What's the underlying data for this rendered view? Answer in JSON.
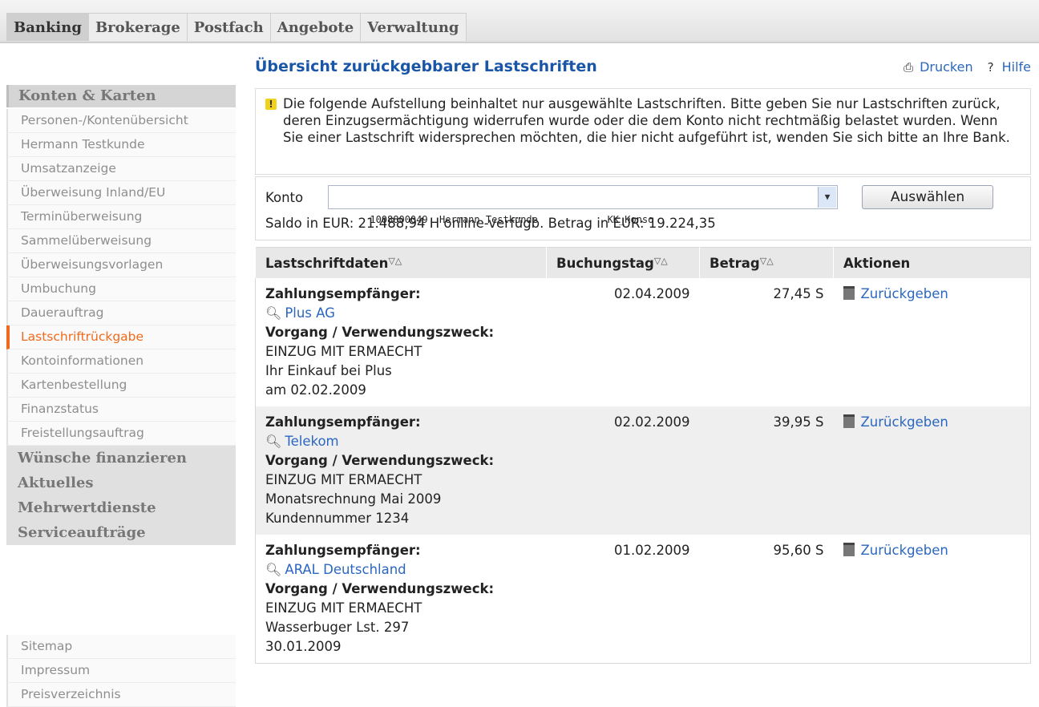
{
  "tabs": [
    "Banking",
    "Brokerage",
    "Postfach",
    "Angebote",
    "Verwaltung"
  ],
  "sidebar": {
    "heading": "Konten & Karten",
    "items": [
      "Personen-/Kontenübersicht",
      "Hermann Testkunde",
      "Umsatzanzeige",
      "Überweisung Inland/EU",
      "Terminüberweisung",
      "Sammelüberweisung",
      "Überweisungsvorlagen",
      "Umbuchung",
      "Dauerauftrag",
      "Lastschriftrückgabe",
      "Kontoinformationen",
      "Kartenbestellung",
      "Finanzstatus",
      "Freistellungsauftrag"
    ],
    "sections": [
      "Wünsche finanzieren",
      "Aktuelles",
      "Mehrwertdienste",
      "Serviceaufträge"
    ],
    "footer": [
      "Sitemap",
      "Impressum",
      "Preisverzeichnis"
    ]
  },
  "main": {
    "title": "Übersicht zurückgebbarer Lastschriften",
    "print_label": "Drucken",
    "help_label": "Hilfe",
    "notice": "Die folgende Aufstellung beinhaltet nur ausgewählte Lastschriften. Bitte geben Sie nur Lastschriften zurück, deren Einzugsermächtigung widerrufen wurde oder die dem Konto nicht rechtmäßig belastet wurden. Wenn Sie einer Lastschrift widersprechen möchten, die hier nicht aufgeführt ist, wenden Sie sich bitte an Ihre Bank.",
    "konto_label": "Konto",
    "konto_value": "1008800049  Hermann Testkunde            KK_Konso",
    "select_button": "Auswählen",
    "saldo": "Saldo in EUR:  21.488,94 H    online-verfügb. Betrag in EUR:  19.224,35"
  },
  "table": {
    "headers": [
      "Lastschriftdaten",
      "Buchungstag",
      "Betrag",
      "Aktionen"
    ],
    "payee_label": "Zahlungsempfänger:",
    "purpose_label": "Vorgang / Verwendungszweck:",
    "action_label": "Zurückgeben",
    "rows": [
      {
        "payee": "Plus AG",
        "purpose": [
          "EINZUG MIT ERMAECHT",
          "Ihr Einkauf bei Plus",
          "am 02.02.2009"
        ],
        "date": "02.04.2009",
        "amount": "27,45 S"
      },
      {
        "payee": "Telekom",
        "purpose": [
          "EINZUG MIT ERMAECHT",
          "Monatsrechnung Mai 2009",
          "Kundennummer 1234"
        ],
        "date": "02.02.2009",
        "amount": "39,95 S"
      },
      {
        "payee": "ARAL Deutschland",
        "purpose": [
          "EINZUG MIT ERMAECHT",
          "Wasserbuger Lst. 297",
          "30.01.2009"
        ],
        "date": "01.02.2009",
        "amount": "95,60 S"
      }
    ]
  },
  "icons": {
    "print": "printer-icon",
    "help": "help-icon",
    "warning": "warning-icon",
    "search": "magnifier-icon",
    "delete": "trash-icon"
  },
  "colors": {
    "accent": "#f06a1b",
    "link": "#2b67c0",
    "title": "#1a56a8"
  }
}
